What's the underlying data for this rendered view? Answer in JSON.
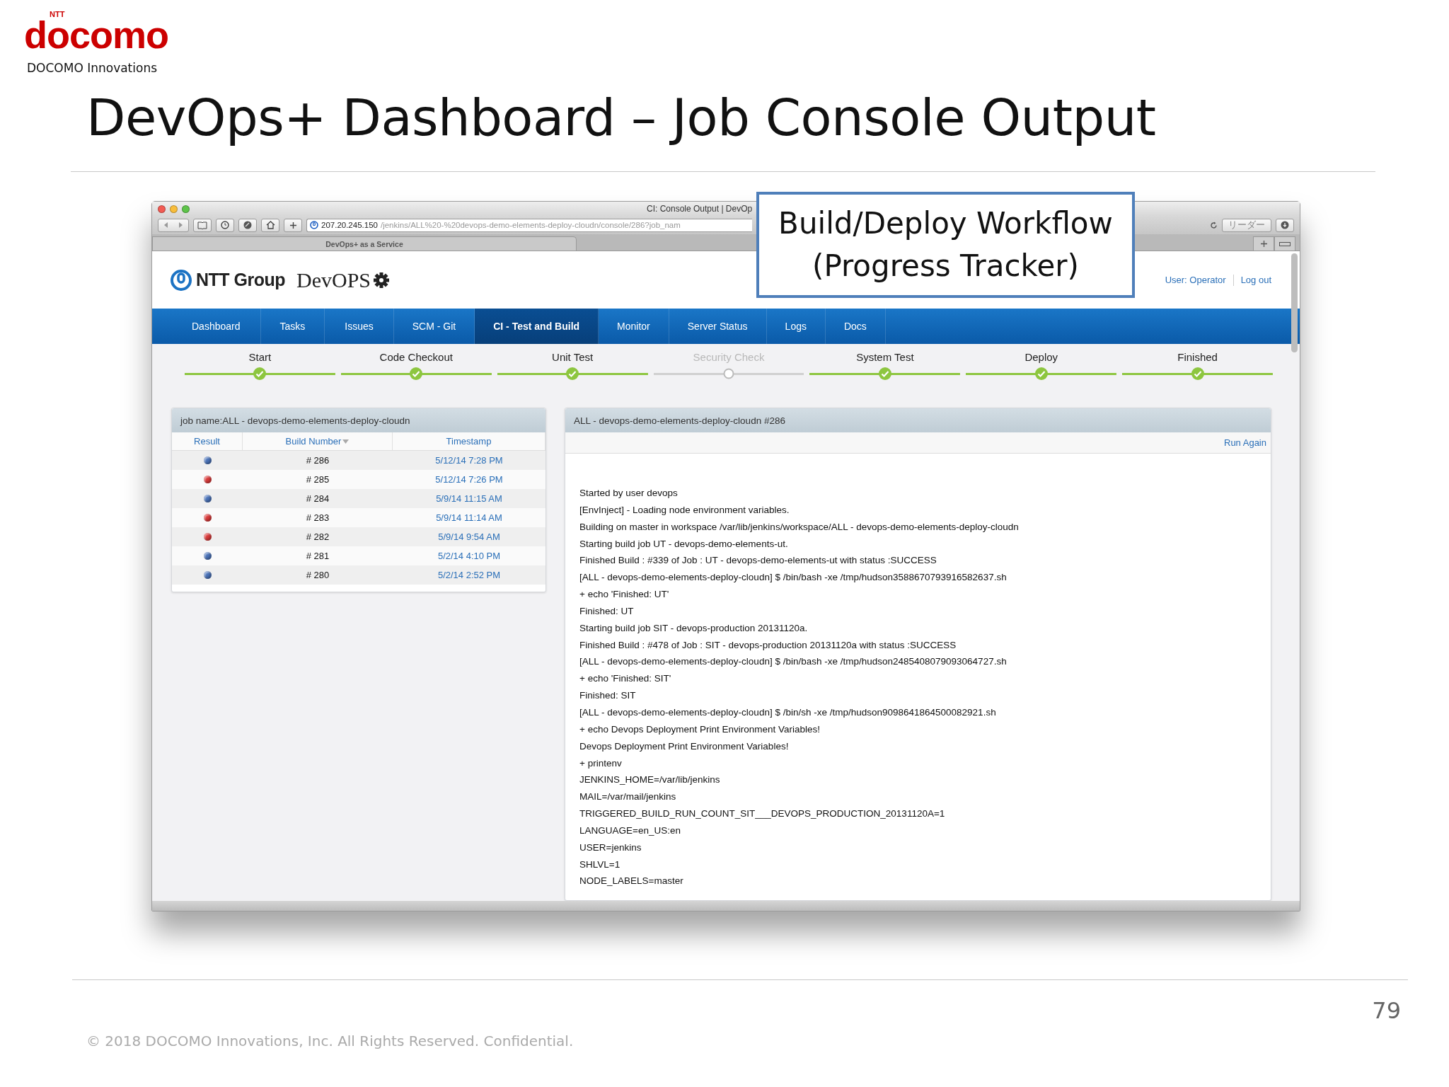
{
  "slide": {
    "brand": {
      "mark": "NTT",
      "logo": "docomo",
      "subtitle": "DOCOMO Innovations"
    },
    "title": "DevOps+ Dashboard – Job Console Output",
    "page_number": "79",
    "footer": "© 2018 DOCOMO Innovations, Inc. All Rights Reserved. Confidential."
  },
  "callout": {
    "lines": [
      "Build/Deploy Workflow",
      "(Progress Tracker)"
    ]
  },
  "browser": {
    "title": "CI: Console Output | DevOp",
    "url_host": "207.20.245.150",
    "url_path": "/jenkins/ALL%20-%20devops-demo-elements-deploy-cloudn/console/286?job_nam",
    "reader_button": "リーダー",
    "tab": "DevOps+ as a Service"
  },
  "app": {
    "brand": "NTT Group",
    "product": "DevOPS",
    "user": "User: Operator",
    "logout": "Log out",
    "nav": [
      {
        "label": "Dashboard",
        "selected": false
      },
      {
        "label": "Tasks",
        "selected": false
      },
      {
        "label": "Issues",
        "selected": false
      },
      {
        "label": "SCM - Git",
        "selected": false
      },
      {
        "label": "CI - Test and Build",
        "selected": true
      },
      {
        "label": "Monitor",
        "selected": false
      },
      {
        "label": "Server Status",
        "selected": false
      },
      {
        "label": "Logs",
        "selected": false
      },
      {
        "label": "Docs",
        "selected": false
      }
    ],
    "tracker": [
      {
        "label": "Start",
        "done": true
      },
      {
        "label": "Code Checkout",
        "done": true
      },
      {
        "label": "Unit Test",
        "done": true
      },
      {
        "label": "Security Check",
        "done": false
      },
      {
        "label": "System Test",
        "done": true
      },
      {
        "label": "Deploy",
        "done": true
      },
      {
        "label": "Finished",
        "done": true
      }
    ],
    "builds": {
      "title": "job name:ALL - devops-demo-elements-deploy-cloudn",
      "columns": [
        "Result",
        "Build Number",
        "Timestamp"
      ],
      "rows": [
        {
          "color": "#4a72b8",
          "number": "# 286",
          "timestamp": "5/12/14 7:28 PM"
        },
        {
          "color": "#d93a3a",
          "number": "# 285",
          "timestamp": "5/12/14 7:26 PM"
        },
        {
          "color": "#4a72b8",
          "number": "# 284",
          "timestamp": "5/9/14 11:15 AM"
        },
        {
          "color": "#d93a3a",
          "number": "# 283",
          "timestamp": "5/9/14 11:14 AM"
        },
        {
          "color": "#d93a3a",
          "number": "# 282",
          "timestamp": "5/9/14 9:54 AM"
        },
        {
          "color": "#4a72b8",
          "number": "# 281",
          "timestamp": "5/2/14 4:10 PM"
        },
        {
          "color": "#4a72b8",
          "number": "# 280",
          "timestamp": "5/2/14 2:52 PM"
        }
      ]
    },
    "console": {
      "title": "ALL - devops-demo-elements-deploy-cloudn #286",
      "action": "Run Again",
      "lines": [
        "Started by user devops",
        "[EnvInject] - Loading node environment variables.",
        "Building on master in workspace /var/lib/jenkins/workspace/ALL - devops-demo-elements-deploy-cloudn",
        "Starting build job UT - devops-demo-elements-ut.",
        "Finished Build : #339 of Job : UT - devops-demo-elements-ut with status :SUCCESS",
        "[ALL - devops-demo-elements-deploy-cloudn] $ /bin/bash -xe /tmp/hudson3588670793916582637.sh",
        "+ echo 'Finished: UT'",
        "Finished: UT",
        "Starting build job SIT - devops-production 20131120a.",
        "Finished Build : #478 of Job : SIT - devops-production 20131120a with status :SUCCESS",
        "[ALL - devops-demo-elements-deploy-cloudn] $ /bin/bash -xe /tmp/hudson2485408079093064727.sh",
        "+ echo 'Finished: SIT'",
        "Finished: SIT",
        "[ALL - devops-demo-elements-deploy-cloudn] $ /bin/sh -xe /tmp/hudson9098641864500082921.sh",
        "+ echo Devops Deployment Print Environment Variables!",
        "Devops Deployment Print Environment Variables!",
        "+ printenv",
        "JENKINS_HOME=/var/lib/jenkins",
        "MAIL=/var/mail/jenkins",
        "TRIGGERED_BUILD_RUN_COUNT_SIT___DEVOPS_PRODUCTION_20131120A=1",
        "LANGUAGE=en_US:en",
        "USER=jenkins",
        "SHLVL=1",
        "NODE_LABELS=master"
      ]
    }
  }
}
